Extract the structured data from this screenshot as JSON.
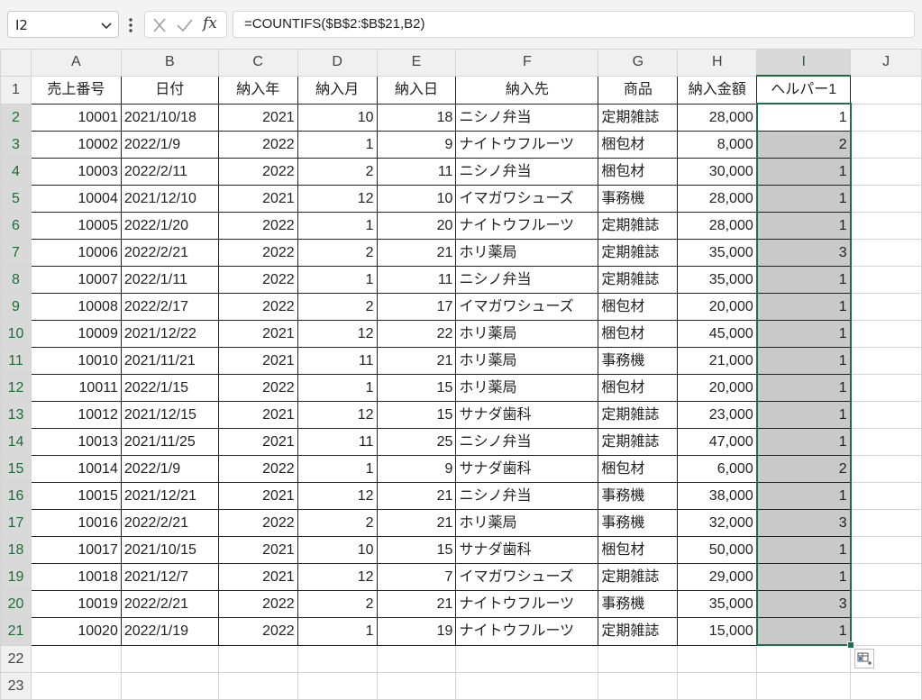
{
  "formula_bar": {
    "name_box": "I2",
    "fx_label": "fx",
    "formula": "=COUNTIFS($B$2:$B$21,B2)"
  },
  "columns": [
    "A",
    "B",
    "C",
    "D",
    "E",
    "F",
    "G",
    "H",
    "I",
    "J"
  ],
  "header_row": [
    "売上番号",
    "日付",
    "納入年",
    "納入月",
    "納入日",
    "納入先",
    "商品",
    "納入金額",
    "ヘルパー1"
  ],
  "rows": [
    [
      "10001",
      "2021/10/18",
      "2021",
      "10",
      "18",
      "ニシノ弁当",
      "定期雑誌",
      "28,000",
      "1"
    ],
    [
      "10002",
      "2022/1/9",
      "2022",
      "1",
      "9",
      "ナイトウフルーツ",
      "梱包材",
      "8,000",
      "2"
    ],
    [
      "10003",
      "2022/2/11",
      "2022",
      "2",
      "11",
      "ニシノ弁当",
      "梱包材",
      "30,000",
      "1"
    ],
    [
      "10004",
      "2021/12/10",
      "2021",
      "12",
      "10",
      "イマガワシューズ",
      "事務機",
      "28,000",
      "1"
    ],
    [
      "10005",
      "2022/1/20",
      "2022",
      "1",
      "20",
      "ナイトウフルーツ",
      "定期雑誌",
      "28,000",
      "1"
    ],
    [
      "10006",
      "2022/2/21",
      "2022",
      "2",
      "21",
      "ホリ薬局",
      "定期雑誌",
      "35,000",
      "3"
    ],
    [
      "10007",
      "2022/1/11",
      "2022",
      "1",
      "11",
      "ニシノ弁当",
      "定期雑誌",
      "35,000",
      "1"
    ],
    [
      "10008",
      "2022/2/17",
      "2022",
      "2",
      "17",
      "イマガワシューズ",
      "梱包材",
      "20,000",
      "1"
    ],
    [
      "10009",
      "2021/12/22",
      "2021",
      "12",
      "22",
      "ホリ薬局",
      "梱包材",
      "45,000",
      "1"
    ],
    [
      "10010",
      "2021/11/21",
      "2021",
      "11",
      "21",
      "ホリ薬局",
      "事務機",
      "21,000",
      "1"
    ],
    [
      "10011",
      "2022/1/15",
      "2022",
      "1",
      "15",
      "ホリ薬局",
      "梱包材",
      "20,000",
      "1"
    ],
    [
      "10012",
      "2021/12/15",
      "2021",
      "12",
      "15",
      "サナダ歯科",
      "定期雑誌",
      "23,000",
      "1"
    ],
    [
      "10013",
      "2021/11/25",
      "2021",
      "11",
      "25",
      "ニシノ弁当",
      "定期雑誌",
      "47,000",
      "1"
    ],
    [
      "10014",
      "2022/1/9",
      "2022",
      "1",
      "9",
      "サナダ歯科",
      "梱包材",
      "6,000",
      "2"
    ],
    [
      "10015",
      "2021/12/21",
      "2021",
      "12",
      "21",
      "ニシノ弁当",
      "事務機",
      "38,000",
      "1"
    ],
    [
      "10016",
      "2022/2/21",
      "2022",
      "2",
      "21",
      "ホリ薬局",
      "事務機",
      "32,000",
      "3"
    ],
    [
      "10017",
      "2021/10/15",
      "2021",
      "10",
      "15",
      "サナダ歯科",
      "梱包材",
      "50,000",
      "1"
    ],
    [
      "10018",
      "2021/12/7",
      "2021",
      "12",
      "7",
      "イマガワシューズ",
      "定期雑誌",
      "29,000",
      "1"
    ],
    [
      "10019",
      "2022/2/21",
      "2022",
      "2",
      "21",
      "ナイトウフルーツ",
      "事務機",
      "35,000",
      "3"
    ],
    [
      "10020",
      "2022/1/19",
      "2022",
      "1",
      "19",
      "ナイトウフルーツ",
      "定期雑誌",
      "15,000",
      "1"
    ]
  ],
  "row_numbers": [
    "1",
    "2",
    "3",
    "4",
    "5",
    "6",
    "7",
    "8",
    "9",
    "10",
    "11",
    "12",
    "13",
    "14",
    "15",
    "16",
    "17",
    "18",
    "19",
    "20",
    "21",
    "22",
    "23"
  ],
  "colors": {
    "selection": "#1e7145",
    "range_fill": "#c9c9c9",
    "header_bg": "#f0f0f0"
  },
  "icons": {
    "quick_analysis": "quick-analysis-icon",
    "name_box_dropdown": "chevron-down-icon"
  }
}
